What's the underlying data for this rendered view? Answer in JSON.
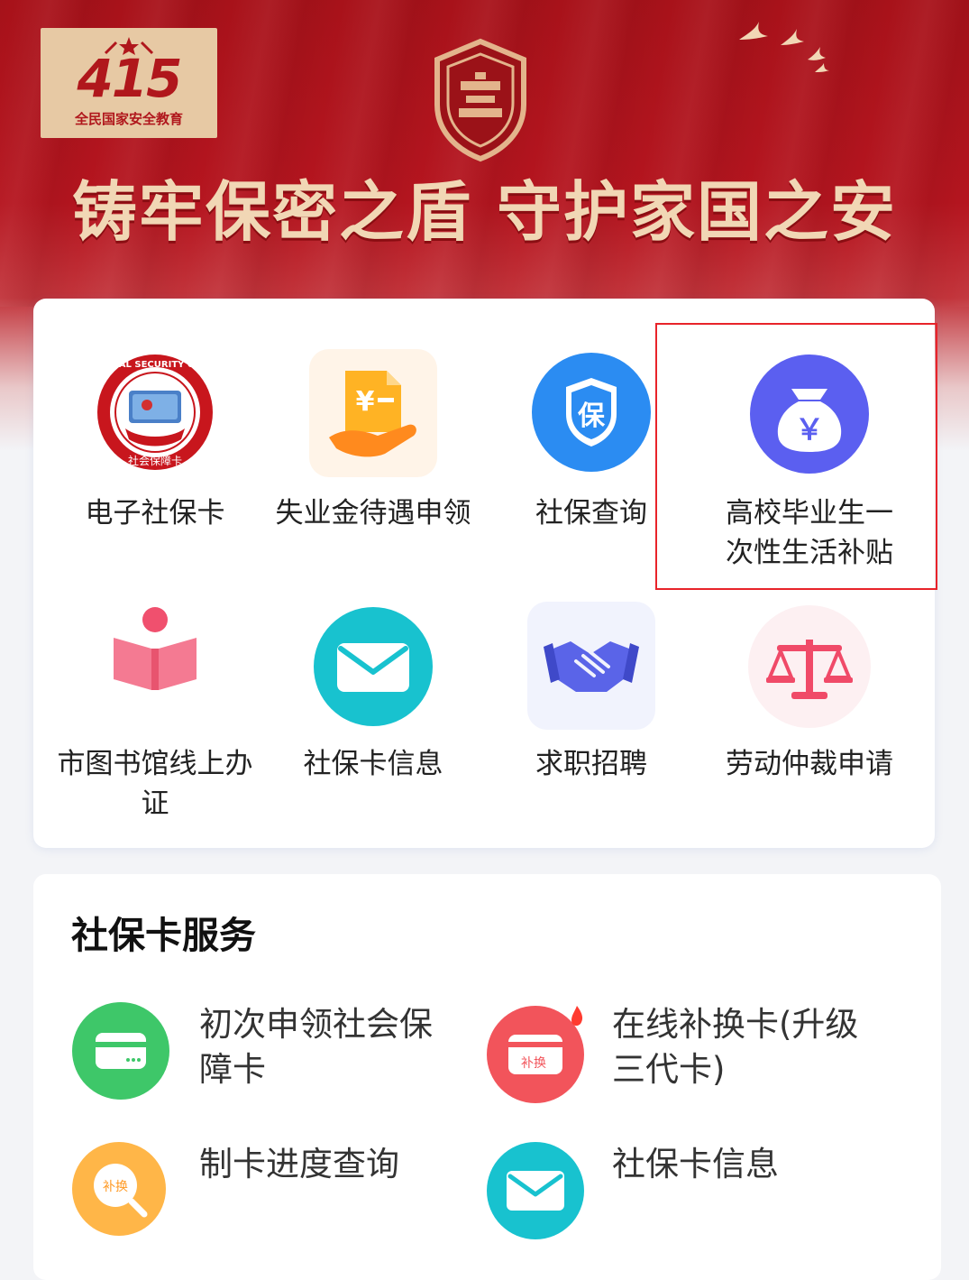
{
  "banner": {
    "badge_number": "415",
    "badge_text": "全民国家安全教育",
    "slogan": "铸牢保密之盾 守护家国之安"
  },
  "colors": {
    "banner_red": "#b5151f",
    "highlight": "#e8232a",
    "gold_text": "#f1d7b5"
  },
  "grid": {
    "items": [
      {
        "label": "电子社保卡",
        "icon": "social-security-card-icon"
      },
      {
        "label": "失业金待遇申领",
        "icon": "unemployment-benefit-icon"
      },
      {
        "label": "社保查询",
        "icon": "social-security-query-icon"
      },
      {
        "label": "高校毕业生一次性生活补贴",
        "icon": "money-bag-icon"
      },
      {
        "label": "市图书馆线上办证",
        "icon": "library-book-icon"
      },
      {
        "label": "社保卡信息",
        "icon": "envelope-icon"
      },
      {
        "label": "求职招聘",
        "icon": "handshake-icon"
      },
      {
        "label": "劳动仲裁申请",
        "icon": "scales-icon"
      }
    ],
    "card_seal_text": "SOCIAL SECURITY CARD",
    "card_seal_text_cn": "社会保障卡",
    "shield_char": "保",
    "money_char": "￥"
  },
  "services": {
    "title": "社保卡服务",
    "items": [
      {
        "label": "初次申领社会保障卡",
        "icon": "green-card-icon"
      },
      {
        "label": "在线补换卡(升级三代卡)",
        "icon": "red-card-replace-icon",
        "icon_text": "补换"
      },
      {
        "label": "制卡进度查询",
        "icon": "orange-progress-icon",
        "icon_text": "补换"
      },
      {
        "label": "社保卡信息",
        "icon": "teal-envelope-icon"
      }
    ]
  }
}
